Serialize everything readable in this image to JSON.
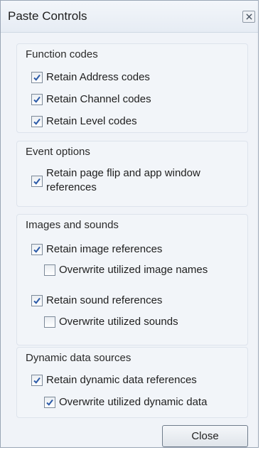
{
  "window": {
    "title": "Paste Controls"
  },
  "groups": {
    "function_codes": {
      "title": "Function codes",
      "items": [
        {
          "label": "Retain Address codes",
          "checked": true
        },
        {
          "label": "Retain Channel codes",
          "checked": true
        },
        {
          "label": "Retain Level codes",
          "checked": true
        }
      ]
    },
    "event_options": {
      "title": "Event options",
      "items": [
        {
          "label": "Retain page flip and app window references",
          "checked": true
        }
      ]
    },
    "images_sounds": {
      "title": "Images and sounds",
      "items": [
        {
          "label": "Retain image references",
          "checked": true
        },
        {
          "label": "Overwrite utilized image names",
          "checked": false
        },
        {
          "label": "Retain sound references",
          "checked": true
        },
        {
          "label": "Overwrite utilized sounds",
          "checked": false
        }
      ]
    },
    "dynamic_data": {
      "title": "Dynamic data sources",
      "items": [
        {
          "label": "Retain dynamic data references",
          "checked": true
        },
        {
          "label": "Overwrite utilized dynamic data",
          "checked": true
        }
      ]
    }
  },
  "buttons": {
    "close_label": "Close"
  }
}
